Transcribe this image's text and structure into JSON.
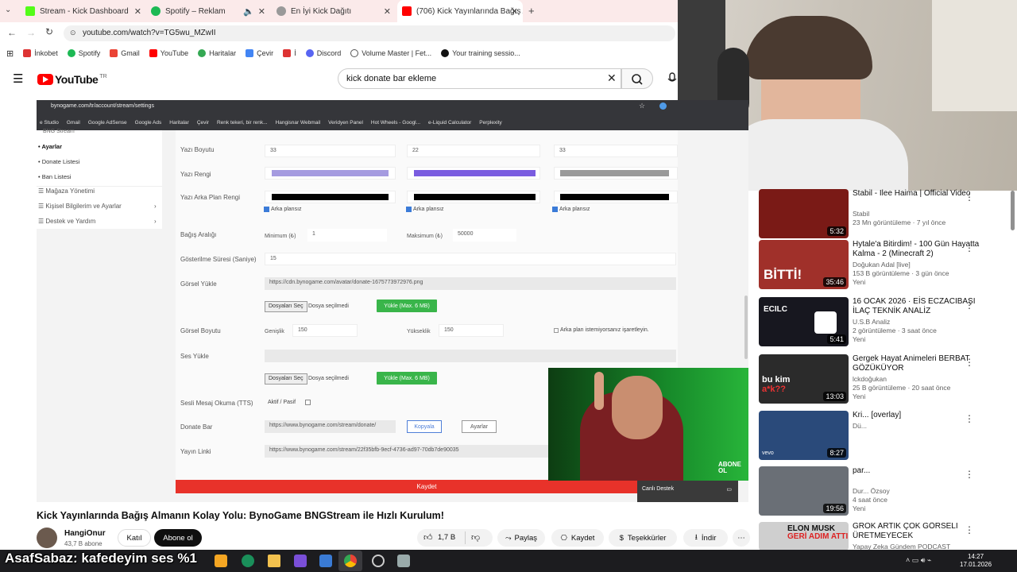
{
  "tabs": [
    {
      "label": "Stream - Kick Dashboard",
      "color": "#53fc18"
    },
    {
      "label": "Spotify – Reklam",
      "color": "#1db954"
    },
    {
      "label": "En İyi Kick Dağıtı",
      "color": "#888888"
    },
    {
      "label": "(706) Kick Yayınlarında Bağış Al...",
      "color": "#ff0000"
    }
  ],
  "address": "youtube.com/watch?v=TG5wu_MZwII",
  "bookmarks": [
    "İnkobet",
    "Spotify",
    "Gmail",
    "YouTube",
    "Haritalar",
    "Çevir",
    "İ",
    "Discord",
    "Volume Master | Fet...",
    "Your training sessio..."
  ],
  "youtube": {
    "logo": "YouTube",
    "region": "TR",
    "search_value": "kick donate bar ekleme"
  },
  "inner_browser": {
    "url": "bynogame.com/tr/account/stream/settings",
    "bookmarks": [
      "e Studio",
      "Gmail",
      "Google AdSense",
      "Google Ads",
      "Haritalar",
      "Çevir",
      "Renk tekeri, bir renk...",
      "Hangisnar Webmail",
      "Veridyen Panel",
      "Hot Wheels - Googl...",
      "e-Liquid Calculator",
      "Perplexity"
    ]
  },
  "side_menu": {
    "header": "BNG Stream",
    "items": [
      "Ayarlar",
      "Donate Listesi",
      "Ban Listesi",
      "Mağaza Yönetimi",
      "Kişisel Bilgilerim ve Ayarlar",
      "Destek ve Yardım"
    ]
  },
  "form": {
    "font_size_label": "Yazı Boyutu",
    "font_sizes": [
      "33",
      "22",
      "33"
    ],
    "font_color_label": "Yazı Rengi",
    "font_colors": [
      "#a59be0",
      "#7a5ce0",
      "#9a9a9a"
    ],
    "bg_color_label": "Yazı Arka Plan Rengi",
    "transparent_label": "Arka plansız",
    "range_label": "Bağış Aralığı",
    "min_label": "Minimum (₺)",
    "min_value": "1",
    "max_label": "Maksimum (₺)",
    "max_value": "50000",
    "duration_label": "Gösterilme Süresi (Saniye)",
    "duration_value": "15",
    "image_label": "Görsel Yükle",
    "image_url": "https://cdn.bynogame.com/avatar/donate-1675773972976.png",
    "file_button": "Dosyaları Seç",
    "no_file": "Dosya seçilmedi",
    "upload_button": "Yükle (Max. 6 MB)",
    "image_size_label": "Görsel Boyutu",
    "width_label": "Genişlik",
    "width_value": "150",
    "height_label": "Yükseklik",
    "height_value": "150",
    "no_bg_note": "Arka plan istemiyorsanız işaretleyin.",
    "sound_label": "Ses Yükle",
    "tts_label": "Sesli Mesaj Okuma (TTS)",
    "tts_toggle": "Aktif / Pasif",
    "donate_bar_label": "Donate Bar",
    "donate_bar_url": "https://www.bynogame.com/stream/donate/",
    "copy_button": "Kopyala",
    "settings_button": "Ayarlar",
    "stream_link_label": "Yayın Linki",
    "stream_link_url": "https://www.bynogame.com/stream/22f35bfb-9ecf-4736-ad97-70db7de90035",
    "save_button": "Kaydet",
    "live_support": "Canlı Destek"
  },
  "webcam_badge": "ABONE OL",
  "video": {
    "title": "Kick Yayınlarında Bağış Almanın Kolay Yolu: BynoGame BNGStream ile Hızlı Kurulum!",
    "channel": "HangiOnur",
    "subscribers": "43,7 B abone",
    "join": "Katıl",
    "subscribe": "Abone ol",
    "likes": "1,7 B",
    "share": "Paylaş",
    "save": "Kaydet",
    "thanks": "Teşekkürler",
    "download": "İndir"
  },
  "recommendations": [
    {
      "title": "Stabil - Ilee Haima | Official Video",
      "channel": "Stabil",
      "meta": "23 Mn görüntüleme · 7 yıl önce",
      "duration": "5:32",
      "color": "#7a1a16"
    },
    {
      "title": "Hytale'a Bitirdim! - 100 Gün Hayatta Kalma - 2 (Minecraft 2)",
      "channel": "Doğukan Adal [live]",
      "meta": "153 B görüntüleme · 3 gün önce",
      "extra": "Yeni",
      "duration": "35:46",
      "color": "#a0302a"
    },
    {
      "title": "16 OCAK 2026 · EİS ECZACIBAŞI İLAÇ TEKNİK ANALİZ",
      "channel": "U.S.B Analiz",
      "meta": "2 görüntüleme · 3 saat önce",
      "extra": "Yeni",
      "duration": "5:41",
      "color": "#17171f"
    },
    {
      "title": "Gergek Hayat Animeleri BERBAT GÖZÜKÜYOR",
      "channel": "lckdoğukan",
      "meta": "25 B görüntüleme · 20 saat önce",
      "extra": "Yeni",
      "duration": "13:03",
      "color": "#2b2b2b"
    },
    {
      "title": "Kri... [overlay]",
      "channel": "Dü...",
      "meta": "",
      "duration": "8:27",
      "color": "#2a4a7a"
    },
    {
      "title": "par...",
      "channel": "Dur... Özsoy",
      "meta": "4 saat önce",
      "extra": "Yeni",
      "duration": "19:56",
      "color": "#6a6f76"
    },
    {
      "title": "GROK ARTIK ÇOK GÖRSELİ ÜRETMEYECEK",
      "channel": "Yapay Zeka Gündem PODCAST",
      "meta": "",
      "duration": "",
      "color": "#cfcfcf"
    }
  ],
  "overlay_text": "AsafSabaz: kafedeyim ses %1",
  "taskbar": {
    "time": "14:27",
    "date": "17.01.2026"
  }
}
